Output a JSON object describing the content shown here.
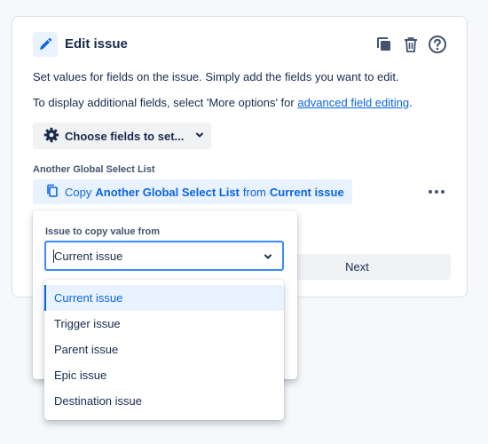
{
  "header": {
    "title": "Edit issue",
    "icons": [
      "pencil-icon",
      "copy-icon",
      "trash-icon",
      "help-icon"
    ]
  },
  "description": {
    "line1": "Set values for fields on the issue. Simply add the fields you want to edit.",
    "line2_prefix": "To display additional fields, select 'More options' for ",
    "line2_link": "advanced field editing",
    "line2_suffix": "."
  },
  "choose_fields": {
    "label": "Choose fields to set...",
    "icon": "gear-icon"
  },
  "field": {
    "label": "Another Global Select List",
    "copy_prefix": "Copy",
    "copy_field": "Another Global Select List",
    "copy_middle": "from",
    "copy_source": "Current issue",
    "more_icon": "more-icon"
  },
  "next_button": {
    "label": "Next"
  },
  "popup": {
    "label": "Issue to copy value from",
    "select_value": "Current issue",
    "options": [
      {
        "label": "Current issue",
        "selected": true
      },
      {
        "label": "Trigger issue",
        "selected": false
      },
      {
        "label": "Parent issue",
        "selected": false
      },
      {
        "label": "Epic issue",
        "selected": false
      },
      {
        "label": "Destination issue",
        "selected": false
      }
    ]
  },
  "colors": {
    "accent": "#0c66e4",
    "accent_bg": "#e9f2ff",
    "focus_border": "#388bff",
    "text": "#172b4d",
    "subtle_text": "#44546f"
  }
}
